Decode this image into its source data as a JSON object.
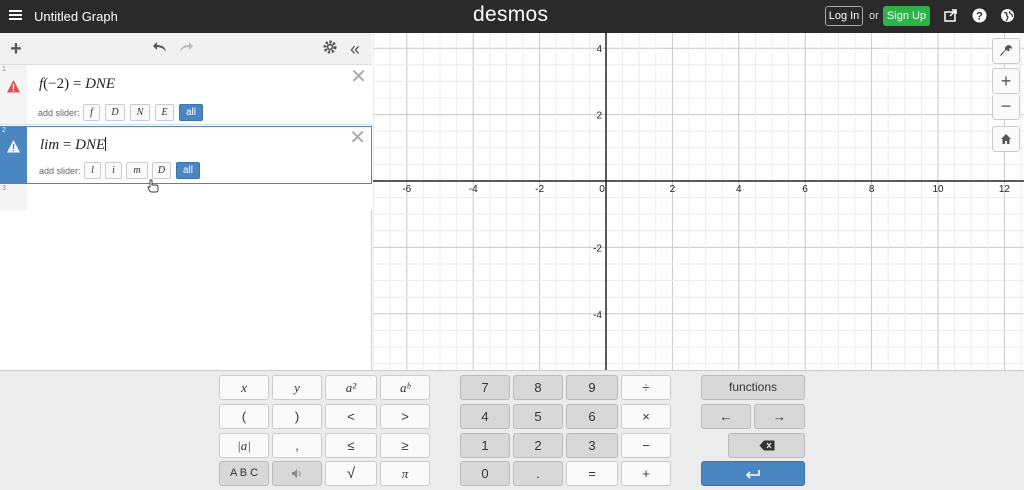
{
  "header": {
    "menu_icon": "hamburger-icon",
    "title": "Untitled Graph",
    "brand": "desmos",
    "login_label": "Log In",
    "or_label": "or",
    "signup_label": "Sign Up",
    "signup_color": "#2eb34a",
    "icons": [
      "share-icon",
      "help-icon",
      "globe-icon"
    ]
  },
  "toolbar": {
    "icons": [
      "add-icon",
      "undo-icon",
      "redo-icon",
      "settings-icon",
      "collapse-icon"
    ]
  },
  "expressions": [
    {
      "num": "1",
      "latex_parts": [
        "f",
        "(−2)",
        " = ",
        "DNE"
      ],
      "has_warning": true,
      "slider_label": "add slider:",
      "sliders": [
        "f",
        "D",
        "N",
        "E"
      ],
      "all_label": "all"
    },
    {
      "num": "2",
      "latex_parts": [
        "lim",
        " = ",
        "DNE"
      ],
      "has_warning": true,
      "selected": true,
      "slider_label": "add slider:",
      "sliders": [
        "l",
        "i",
        "m",
        "D"
      ],
      "all_label": "all"
    },
    {
      "num": "3"
    }
  ],
  "graph": {
    "x_ticks": [
      "-6",
      "-4",
      "-2",
      "0",
      "2",
      "4",
      "6",
      "8",
      "10",
      "12"
    ],
    "y_ticks": [
      "4",
      "2",
      "-2",
      "-4"
    ],
    "side_buttons": [
      "wrench-icon",
      "zoom-in-icon",
      "zoom-out-icon",
      "home-icon"
    ]
  },
  "keypad": {
    "left": {
      "rows": [
        [
          "x",
          "y",
          "a²",
          "aᵇ"
        ],
        [
          "(",
          ")",
          "<",
          ">"
        ],
        [
          "|a|",
          ",",
          "≤",
          "≥"
        ],
        [
          "A B C",
          "🔊",
          "√",
          "π"
        ]
      ]
    },
    "middle": {
      "rows": [
        [
          "7",
          "8",
          "9",
          "÷"
        ],
        [
          "4",
          "5",
          "6",
          "×"
        ],
        [
          "1",
          "2",
          "3",
          "−"
        ],
        [
          "0",
          ".",
          "=",
          "+"
        ]
      ]
    },
    "right": {
      "functions_label": "functions",
      "left_arrow": "←",
      "right_arrow": "→",
      "backspace": "backspace-icon",
      "enter": "enter-icon"
    }
  },
  "colors": {
    "accent": "#4a86c0",
    "warning": "#d9534f",
    "header_bg": "#2a2a2a"
  }
}
